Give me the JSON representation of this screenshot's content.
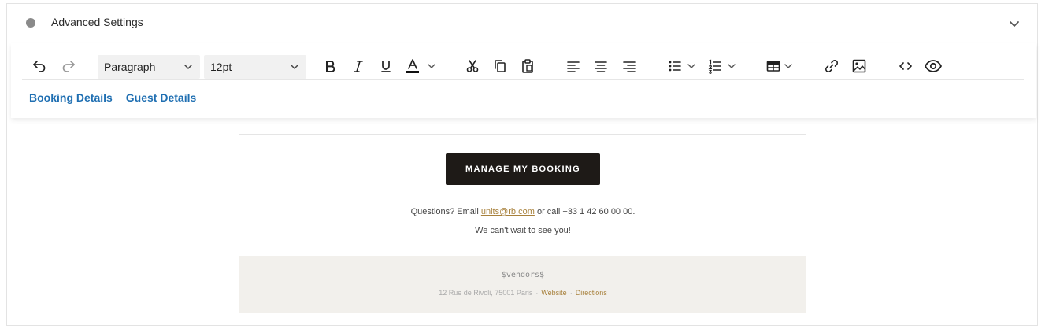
{
  "advanced": {
    "title": "Advanced Settings"
  },
  "toolbar": {
    "block_format": "Paragraph",
    "font_size": "12pt",
    "icons": [
      "undo-icon",
      "redo-icon",
      "bold-icon",
      "italic-icon",
      "underline-icon",
      "text-color-icon",
      "cut-icon",
      "copy-icon",
      "paste-icon",
      "align-left-icon",
      "align-center-icon",
      "align-right-icon",
      "bullet-list-icon",
      "numbered-list-icon",
      "table-icon",
      "link-icon",
      "image-icon",
      "code-icon",
      "preview-icon"
    ]
  },
  "merge_tags": [
    "Booking Details",
    "Guest Details"
  ],
  "email": {
    "cta_label": "MANAGE MY BOOKING",
    "questions_prefix": "Questions? Email ",
    "questions_email": "units@rb.com",
    "questions_suffix": " or call +33 1 42 60 00 00.",
    "closing": "We can't wait to see you!",
    "vendor_placeholder": "_$vendors$_",
    "address": "12 Rue de Rivoli, 75001 Paris",
    "address_sep": "·",
    "website_label": "Website",
    "link_sep": "·",
    "directions_label": "Directions"
  },
  "colors": {
    "link": "#1f6fb2",
    "gold": "#a8813c",
    "cta_bg": "#1e1a17",
    "footer_bg": "#f2f0ec"
  }
}
